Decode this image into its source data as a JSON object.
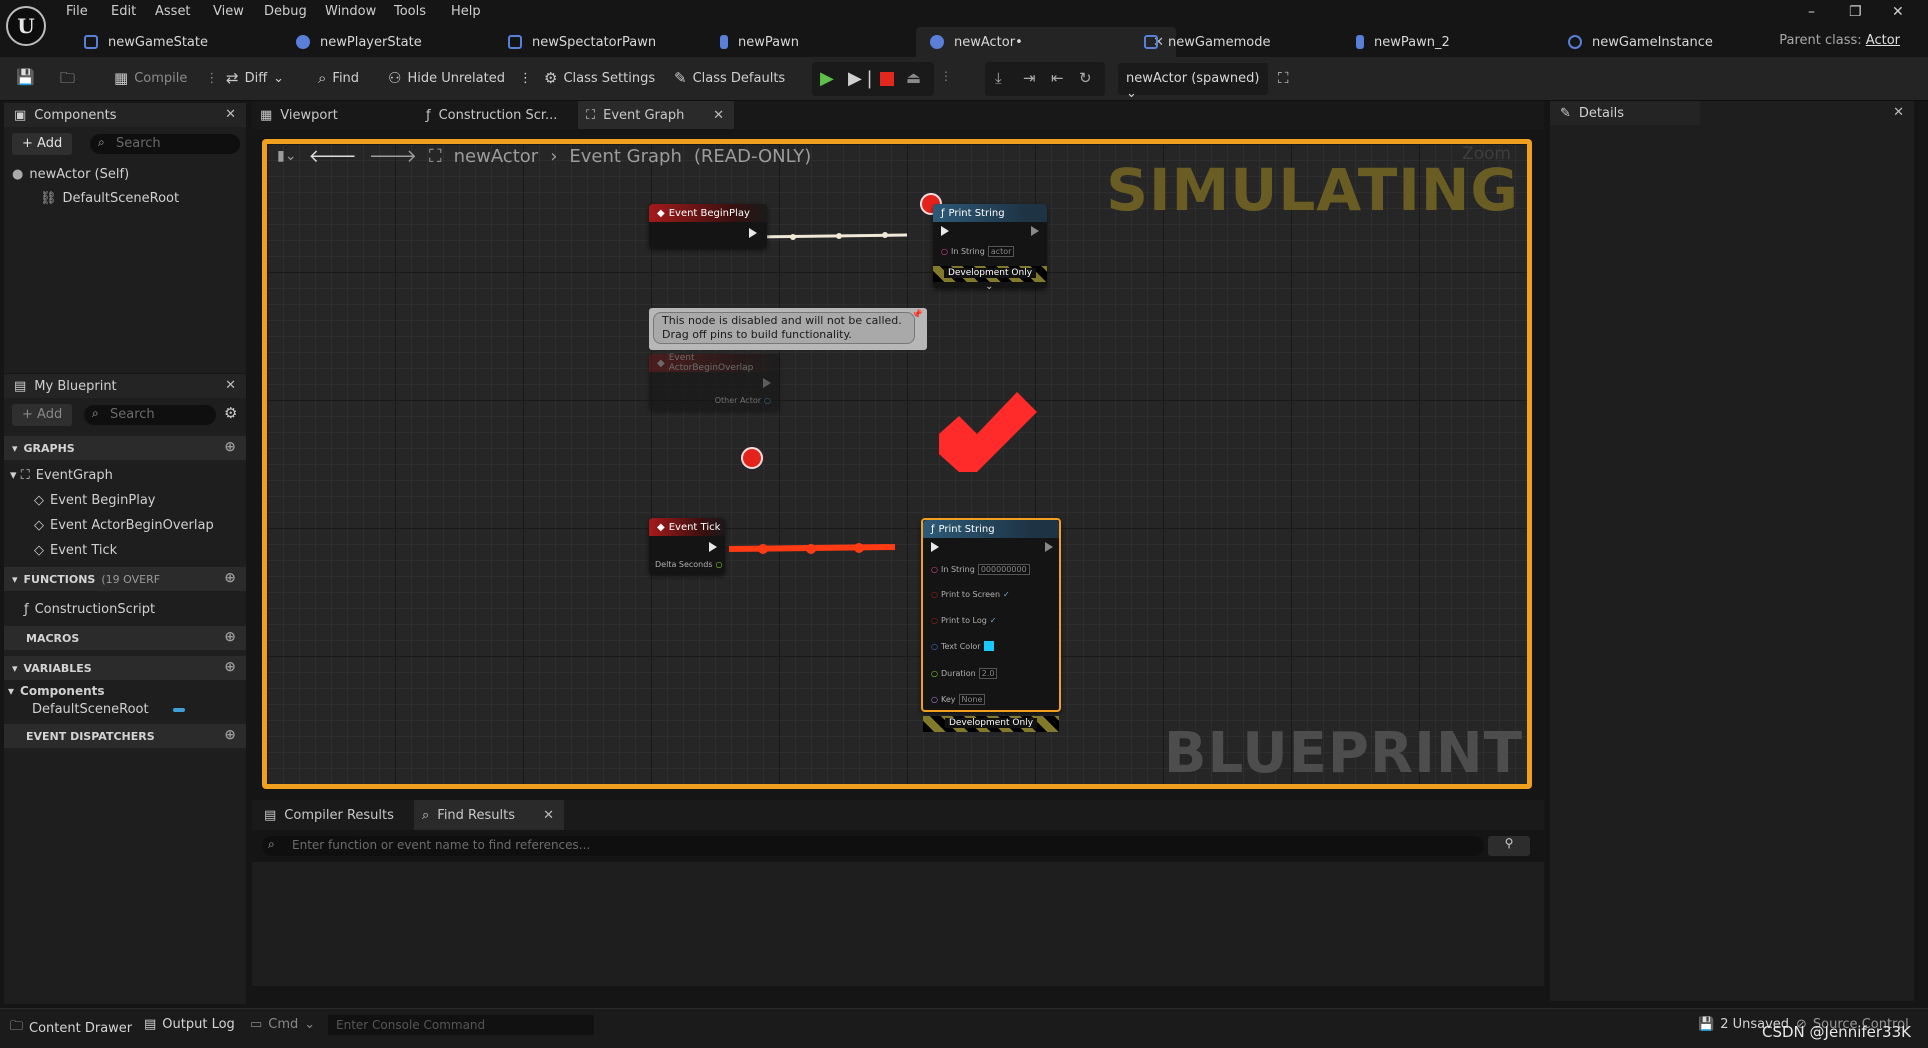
{
  "menu": [
    "File",
    "Edit",
    "Asset",
    "View",
    "Debug",
    "Window",
    "Tools",
    "Help"
  ],
  "window_controls": {
    "minimize": "–",
    "restore": "❐",
    "close": "✕"
  },
  "doc_tabs": [
    {
      "label": "newGameState"
    },
    {
      "label": "newPlayerState"
    },
    {
      "label": "newSpectatorPawn"
    },
    {
      "label": "newPawn"
    },
    {
      "label": "newActor•"
    },
    {
      "label": "newGamemode"
    },
    {
      "label": "newPawn_2"
    },
    {
      "label": "newGameInstance"
    }
  ],
  "parent_class": {
    "label": "Parent class:",
    "value": "Actor"
  },
  "toolbar": {
    "compile": "Compile",
    "diff": "Diff",
    "find": "Find",
    "hide_unrelated": "Hide Unrelated",
    "class_settings": "Class Settings",
    "class_defaults": "Class Defaults",
    "debug_object": "newActor (spawned)"
  },
  "components_panel": {
    "title": "Components",
    "add": "+ Add",
    "search_placeholder": "Search",
    "items": [
      "newActor (Self)",
      "DefaultSceneRoot"
    ]
  },
  "my_blueprint": {
    "title": "My Blueprint",
    "add": "+ Add",
    "search_placeholder": "Search",
    "graphs_label": "GRAPHS",
    "event_graph": "EventGraph",
    "events": [
      "Event BeginPlay",
      "Event ActorBeginOverlap",
      "Event Tick"
    ],
    "functions_label": "FUNCTIONS",
    "functions_count": "(19 OVERF",
    "construction_script": "ConstructionScript",
    "macros_label": "MACROS",
    "variables_label": "VARIABLES",
    "components_group": "Components",
    "default_scene_root": "DefaultSceneRoot",
    "dispatchers_label": "EVENT DISPATCHERS"
  },
  "graph_tabs": [
    "Viewport",
    "Construction Scr...",
    "Event Graph"
  ],
  "breadcrumb": {
    "root": "newActor",
    "graph": "Event Graph",
    "mode": "(READ-ONLY)",
    "zoom": "Zoom"
  },
  "watermarks": {
    "top": "SIMULATING",
    "bottom": "BLUEPRINT"
  },
  "nodes": {
    "begin_play": "Event BeginPlay",
    "print1": {
      "title": "Print String",
      "in_string_label": "In String",
      "in_string_value": "actor",
      "dev_only": "Development Only"
    },
    "disabled_note": "This node is disabled and will not be called. Drag off pins to build functionality.",
    "begin_overlap": {
      "title": "Event ActorBeginOverlap",
      "other_actor": "Other Actor"
    },
    "tick": {
      "title": "Event Tick",
      "delta": "Delta Seconds"
    },
    "print2": {
      "title": "Print String",
      "in_string_label": "In String",
      "in_string_value": "000000000",
      "print_to_screen": "Print to Screen",
      "print_to_log": "Print to Log",
      "text_color": "Text Color",
      "duration_label": "Duration",
      "duration_value": "2.0",
      "key_label": "Key",
      "key_value": "None",
      "dev_only": "Development Only"
    }
  },
  "bottom_tabs": [
    "Compiler Results",
    "Find Results"
  ],
  "find_placeholder": "Enter function or event name to find references...",
  "details_title": "Details",
  "statusbar": {
    "content_drawer": "Content Drawer",
    "output_log": "Output Log",
    "cmd": "Cmd",
    "console_placeholder": "Enter Console Command",
    "unsaved": "2 Unsaved",
    "source_control": "Source Control",
    "watermark": "CSDN @Jennifer33K"
  },
  "colors": {
    "accent": "#f0a01e",
    "event_head": "#a51a1a",
    "func_head": "#2d5a78",
    "exec_wire": "#f0e8d8",
    "active_wire": "#ff3b14",
    "breakpoint": "#e3231c",
    "text_color_swatch": "#18c8ff"
  }
}
